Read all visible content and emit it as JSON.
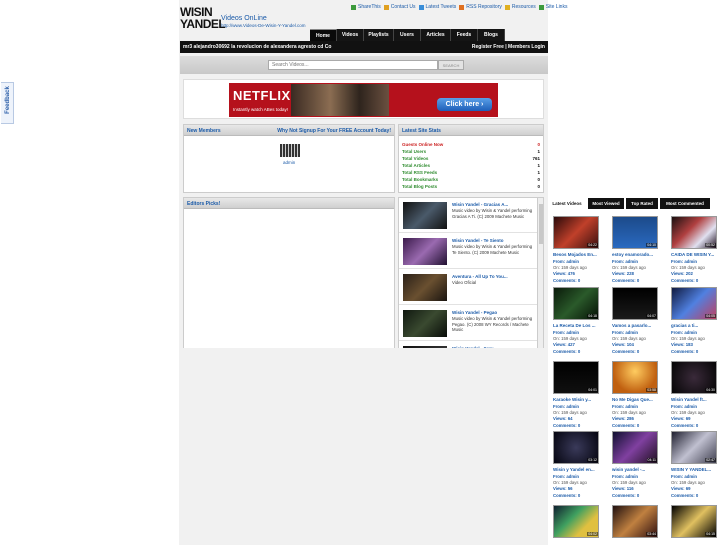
{
  "feedback_label": "Feedback",
  "header": {
    "logo_line1": "WISIN",
    "logo_line2": "YANDEL",
    "site_title": "Videos OnLine",
    "site_url": "http://www.Videos-De-Wisin-Y-Yandel.com",
    "top_links": [
      {
        "label": "ShareThis",
        "icon": "share-icon",
        "color": "#3c9a3c"
      },
      {
        "label": "Contact Us",
        "icon": "mail-icon",
        "color": "#e0a020"
      },
      {
        "label": "Latest Tweets",
        "icon": "twitter-icon",
        "color": "#3b8ed8"
      },
      {
        "label": "RSS Repository",
        "icon": "rss-icon",
        "color": "#e07020"
      },
      {
        "label": "Resources",
        "icon": "star-icon",
        "color": "#e0b020"
      },
      {
        "label": "Site Links",
        "icon": "link-icon",
        "color": "#3c9a3c"
      }
    ]
  },
  "nav": {
    "tabs": [
      "Home",
      "Videos",
      "Playlists",
      "Users",
      "Articles",
      "Feeds",
      "Blogs"
    ]
  },
  "bar": {
    "ticker": "mr3 alejandro30692  la revolucion de alexandera agresto cd Co",
    "register": "Register Free | Members Login"
  },
  "search": {
    "placeholder": "Search Videos...",
    "button": "SEARCH"
  },
  "ad": {
    "brand": "NETFLIX",
    "sub": "Instantly watch ABes today!",
    "cta": "Click here ›"
  },
  "members": {
    "title": "New Members",
    "cta": "Why Not Signup For Your FREE Account Today!",
    "user": "admin"
  },
  "stats": {
    "title": "Latest Site Stats",
    "rows": [
      {
        "label": "Guests Online Now",
        "value": "0"
      },
      {
        "label": "Total Users",
        "value": "1"
      },
      {
        "label": "Total Videos",
        "value": "761"
      },
      {
        "label": "Total Articles",
        "value": "1"
      },
      {
        "label": "Total RSS Feeds",
        "value": "1"
      },
      {
        "label": "Total Bookmarks",
        "value": "0"
      },
      {
        "label": "Total Blog Posts",
        "value": "0"
      }
    ]
  },
  "editors": {
    "title": "Editors Picks!"
  },
  "vlist": [
    {
      "title": "Wisin Yandel - Gracias A...",
      "desc": "Music video by Wisin & Yandel performing Gracias A Ti. (C) 2009 Machete Music"
    },
    {
      "title": "Wisin Yandel - Te Siento",
      "desc": "Music video by Wisin & Yandel performing Te Siento. (C) 2009 Machete Music"
    },
    {
      "title": "Aventura - All Up To You...",
      "desc": "Video Oficial"
    },
    {
      "title": "Wisin Yandel - Pegao",
      "desc": "Music video by Wisin & Yandel performing Pegao. (C) 2008 WY Records / Machete Music"
    },
    {
      "title": "Wisin Yandel - Serv...",
      "desc": ""
    }
  ],
  "right_tabs": [
    "Latest Videos",
    "Most Viewed",
    "Top Rated",
    "Most Commented"
  ],
  "right_videos": [
    {
      "title": "Besos Mojados En...",
      "from": "From: admin",
      "on": "On: 159 days ago",
      "views": "Views: 476",
      "comments": "Comments: 0",
      "dur": "04:22"
    },
    {
      "title": "estoy enamorado...",
      "from": "From: admin",
      "on": "On: 159 days ago",
      "views": "Views: 228",
      "comments": "Comments: 0",
      "dur": "04:10"
    },
    {
      "title": "CAIDA DE WISIN Y...",
      "from": "From: admin",
      "on": "On: 159 days ago",
      "views": "Views: 202",
      "comments": "Comments: 0",
      "dur": "00:52"
    },
    {
      "title": "La Receta De Los ...",
      "from": "From: admin",
      "on": "On: 159 days ago",
      "views": "Views: 427",
      "comments": "Comments: 0",
      "dur": "04:18"
    },
    {
      "title": "Vamos a pasarlo...",
      "from": "From: admin",
      "on": "On: 159 days ago",
      "views": "Views: 104",
      "comments": "Comments: 0",
      "dur": "04:07"
    },
    {
      "title": "gracias a ti...",
      "from": "From: admin",
      "on": "On: 159 days ago",
      "views": "Views: 183",
      "comments": "Comments: 0",
      "dur": "04:05"
    },
    {
      "title": "Karaoke Wisin y...",
      "from": "From: admin",
      "on": "On: 159 days ago",
      "views": "Views: 64",
      "comments": "Comments: 0",
      "dur": "04:01"
    },
    {
      "title": "No Me Digas Que...",
      "from": "From: admin",
      "on": "On: 159 days ago",
      "views": "Views: 286",
      "comments": "Comments: 0",
      "dur": "03:58"
    },
    {
      "title": "Wisin Yandel ft...",
      "from": "From: admin",
      "on": "On: 159 days ago",
      "views": "Views: 69",
      "comments": "Comments: 0",
      "dur": "04:30"
    },
    {
      "title": "Wisin y Yandel en...",
      "from": "From: admin",
      "on": "On: 159 days ago",
      "views": "Views: 56",
      "comments": "Comments: 0",
      "dur": "03:12"
    },
    {
      "title": "wisin yandel -...",
      "from": "From: admin",
      "on": "On: 159 days ago",
      "views": "Views: 116",
      "comments": "Comments: 0",
      "dur": "04:11"
    },
    {
      "title": "WISIN Y YANDEL...",
      "from": "From: admin",
      "on": "On: 159 days ago",
      "views": "Views: 69",
      "comments": "Comments: 0",
      "dur": "02:47"
    },
    {
      "title": "",
      "from": "",
      "on": "",
      "views": "",
      "comments": "",
      "dur": "04:02"
    },
    {
      "title": "",
      "from": "",
      "on": "",
      "views": "",
      "comments": "",
      "dur": "03:44"
    },
    {
      "title": "",
      "from": "",
      "on": "",
      "views": "",
      "comments": "",
      "dur": "04:15"
    }
  ]
}
